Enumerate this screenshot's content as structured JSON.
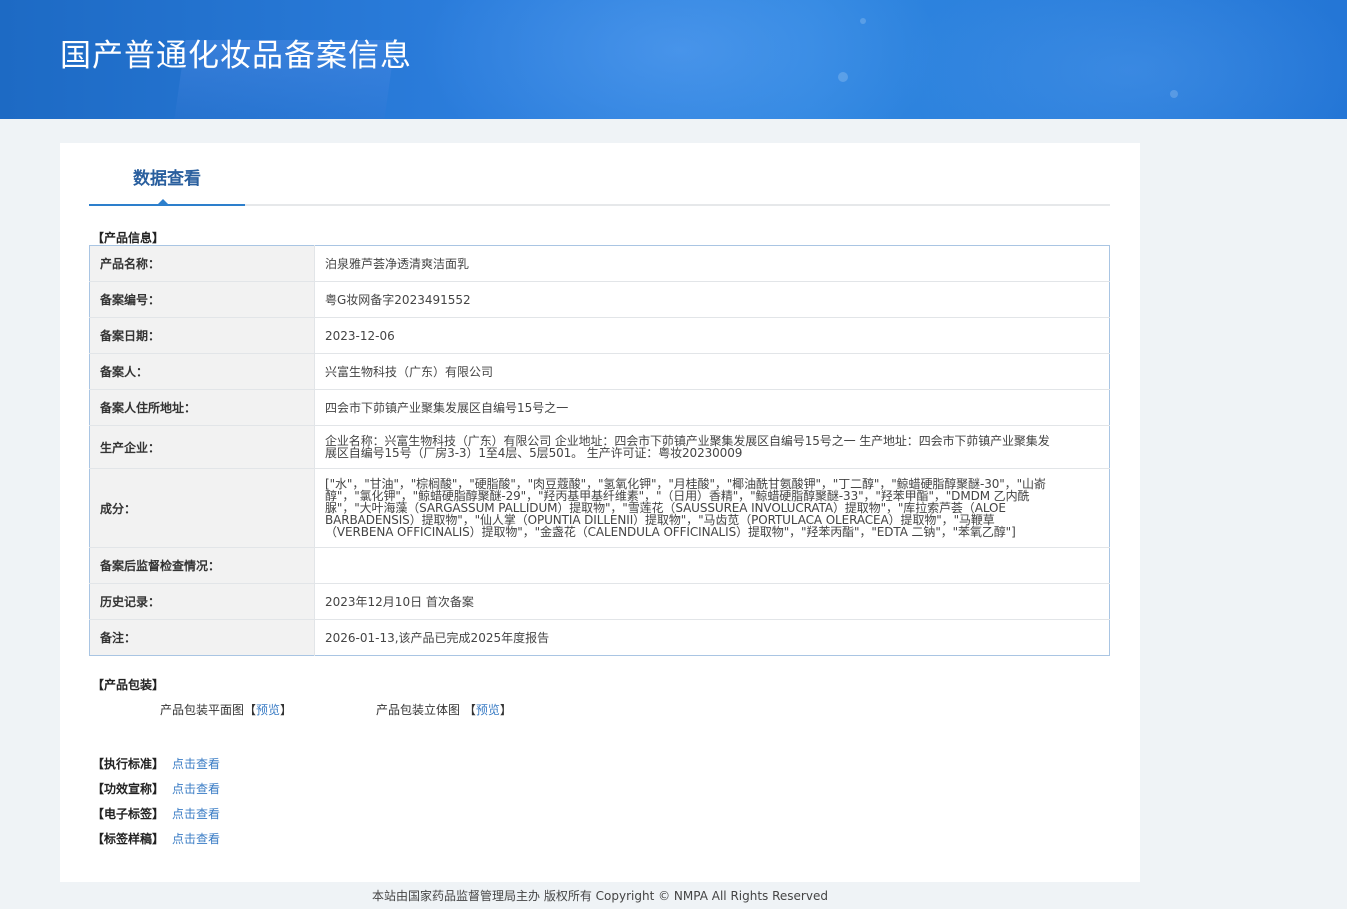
{
  "header": {
    "title": "国产普通化妆品备案信息"
  },
  "tabs": [
    {
      "label": "数据查看"
    }
  ],
  "product_info": {
    "section_label": "【产品信息】",
    "rows": [
      {
        "key": "产品名称：",
        "value": "泊泉雅芦荟净透清爽洁面乳"
      },
      {
        "key": "备案编号：",
        "value": "粤G妆网备字2023491552"
      },
      {
        "key": "备案日期：",
        "value": "2023-12-06"
      },
      {
        "key": "备案人：",
        "value": "兴富生物科技（广东）有限公司"
      },
      {
        "key": "备案人住所地址：",
        "value": "四会市下茆镇产业聚集发展区自编号15号之一"
      },
      {
        "key": "生产企业：",
        "value": "企业名称：兴富生物科技（广东）有限公司 企业地址：四会市下茆镇产业聚集发展区自编号15号之一 生产地址：四会市下茆镇产业聚集发展区自编号15号（厂房3-3）1至4层、5层501。 生产许可证：粤妆20230009"
      },
      {
        "key": "成分：",
        "value": "[\"水\"，\"甘油\"，\"棕榈酸\"，\"硬脂酸\"，\"肉豆蔻酸\"，\"氢氧化钾\"，\"月桂酸\"，\"椰油酰甘氨酸钾\"，\"丁二醇\"，\"鲸蜡硬脂醇聚醚-30\"，\"山嵛醇\"，\"氯化钾\"，\"鲸蜡硬脂醇聚醚-29\"，\"羟丙基甲基纤维素\"，\"（日用）香精\"，\"鲸蜡硬脂醇聚醚-33\"，\"羟苯甲酯\"，\"DMDM 乙内酰脲\"，\"大叶海藻（SARGASSUM PALLIDUM）提取物\"，\"雪莲花（SAUSSUREA INVOLUCRATA）提取物\"，\"库拉索芦荟（ALOE BARBADENSIS）提取物\"，\"仙人掌（OPUNTIA DILLENII）提取物\"，\"马齿苋（PORTULACA OLERACEA）提取物\"，\"马鞭草（VERBENA OFFICINALIS）提取物\"，\"金盏花（CALENDULA OFFICINALIS）提取物\"，\"羟苯丙酯\"，\"EDTA 二钠\"，\"苯氧乙醇\"]"
      },
      {
        "key": "备案后监督检查情况：",
        "value": ""
      },
      {
        "key": "历史记录：",
        "value": "2023年12月10日 首次备案"
      },
      {
        "key": "备注：",
        "value": "2026-01-13,该产品已完成2025年度报告"
      }
    ]
  },
  "packaging": {
    "section_label": "【产品包装】",
    "flat_label": "产品包装平面图",
    "solid_label": "产品包装立体图",
    "bracket_open": "【",
    "bracket_close": "】",
    "preview_link": "预览"
  },
  "standards": [
    {
      "label": "【执行标准】",
      "link": "点击查看"
    },
    {
      "label": "【功效宣称】",
      "link": "点击查看"
    },
    {
      "label": "【电子标签】",
      "link": "点击查看"
    },
    {
      "label": "【标签样稿】",
      "link": "点击查看"
    }
  ],
  "footer": {
    "text": "本站由国家药品监督管理局主办 版权所有 Copyright © NMPA All Rights Reserved"
  },
  "colors": {
    "banner": "#2b7ddc",
    "tab_accent": "#2d7fcc",
    "link": "#3a7cc5",
    "table_border": "#a9c5e3"
  }
}
